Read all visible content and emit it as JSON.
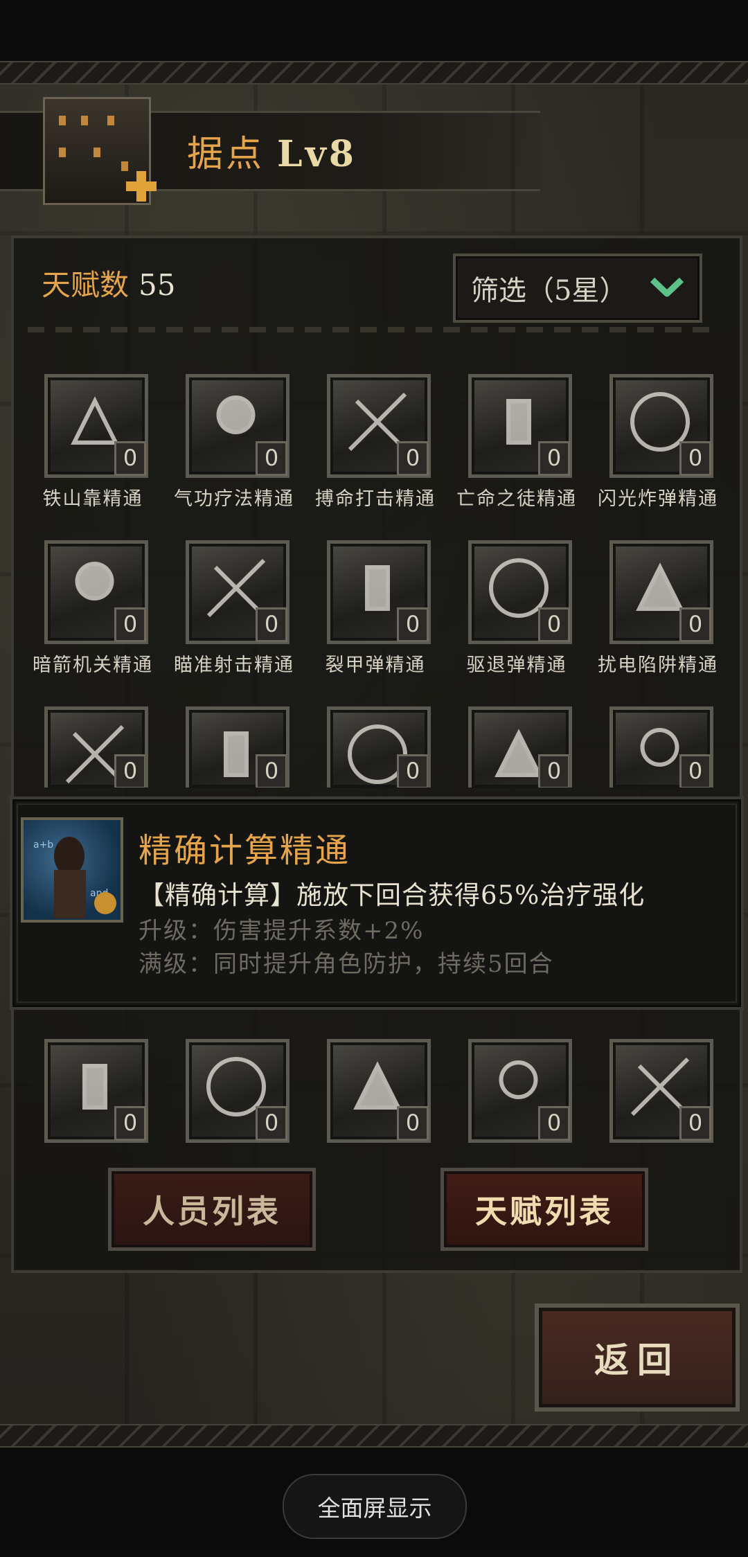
{
  "header": {
    "title": "据点",
    "level": "Lv8"
  },
  "talents": {
    "count_label": "天赋数",
    "count": "55",
    "filter_label": "筛选（5星）"
  },
  "grid": {
    "rows": [
      [
        {
          "name": "铁山靠精通",
          "count": "0",
          "icon": "shoulder-charge-icon"
        },
        {
          "name": "气功疗法精通",
          "count": "0",
          "icon": "qigong-icon"
        },
        {
          "name": "搏命打击精通",
          "count": "0",
          "icon": "desperate-strike-icon"
        },
        {
          "name": "亡命之徒精通",
          "count": "0",
          "icon": "outlaw-icon"
        },
        {
          "name": "闪光炸弹精通",
          "count": "0",
          "icon": "flashbang-icon"
        }
      ],
      [
        {
          "name": "暗箭机关精通",
          "count": "0",
          "icon": "hidden-arrow-trap-icon"
        },
        {
          "name": "瞄准射击精通",
          "count": "0",
          "icon": "aimed-shot-icon"
        },
        {
          "name": "裂甲弹精通",
          "count": "0",
          "icon": "armor-piercing-bullet-icon"
        },
        {
          "name": "驱退弹精通",
          "count": "0",
          "icon": "repel-bullet-icon"
        },
        {
          "name": "扰电陷阱精通",
          "count": "0",
          "icon": "shock-trap-icon"
        }
      ],
      [
        {
          "name": "",
          "count": "0",
          "icon": "flask-icon"
        },
        {
          "name": "",
          "count": "0",
          "icon": "scroll-icon"
        },
        {
          "name": "",
          "count": "0",
          "icon": "lightning-icon"
        },
        {
          "name": "",
          "count": "0",
          "icon": "lightning-cloth-icon"
        },
        {
          "name": "",
          "count": "0",
          "icon": "skull-icon"
        }
      ],
      [
        {
          "name": "",
          "count": "0",
          "icon": "armored-arm-icon"
        },
        {
          "name": "",
          "count": "0",
          "icon": "explosion-icon"
        },
        {
          "name": "",
          "count": "0",
          "icon": "precise-calculation-icon"
        },
        {
          "name": "",
          "count": "0",
          "icon": "black-hole-icon"
        },
        {
          "name": "",
          "count": "0",
          "icon": "vortex-icon"
        }
      ]
    ]
  },
  "tooltip": {
    "title": "精确计算精通",
    "description": "【精确计算】施放下回合获得65%治疗强化",
    "upgrade": "升级：伤害提升系数+2%",
    "max_level": "满级：同时提升角色防护，持续5回合"
  },
  "buttons": {
    "personnel_list": "人员列表",
    "talent_list": "天赋列表",
    "back": "返回",
    "fullscreen": "全面屏显示"
  },
  "colors": {
    "accent_gold": "#e6a54a",
    "badge_text": "#d8d2c4",
    "button_red": "#3a1c17"
  }
}
